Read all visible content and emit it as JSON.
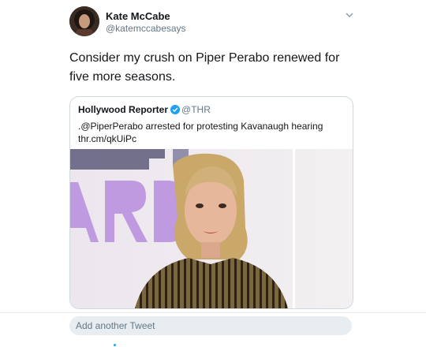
{
  "tweet": {
    "author_name": "Kate McCabe",
    "author_handle": "@katemccabesays",
    "text": "Consider my crush on Piper Perabo renewed for five more seasons."
  },
  "quote": {
    "author_name": "Hollywood Reporter",
    "author_handle": "@THR",
    "text_line1": ".@PiperPerabo arrested for protesting Kavanaugh hearing",
    "text_line2": "thr.cm/qkUiPc"
  },
  "reply": {
    "placeholder": "Add another Tweet"
  },
  "colors": {
    "accent": "#1da1f2",
    "muted_text": "#657786",
    "border": "#cfd9de"
  },
  "icons": [
    "chevron-down-icon",
    "verified-badge-icon"
  ]
}
